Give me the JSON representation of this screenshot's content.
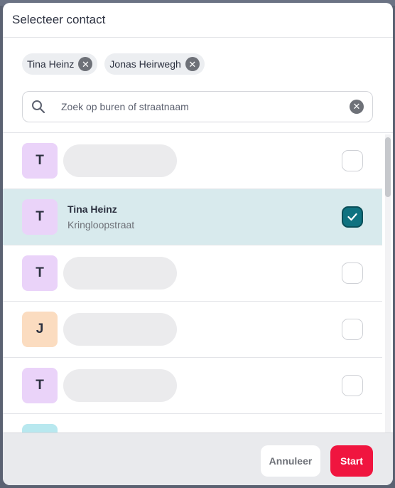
{
  "dialog": {
    "title": "Selecteer contact"
  },
  "selected_chips": [
    {
      "label": "Tina Heinz"
    },
    {
      "label": "Jonas Heirwegh"
    }
  ],
  "search": {
    "placeholder": "Zoek op buren of straatnaam",
    "value": ""
  },
  "contacts": [
    {
      "initial": "T",
      "name": "",
      "street": "",
      "avatar_color": "#ead3f9",
      "checked": false,
      "loaded": false
    },
    {
      "initial": "T",
      "name": "Tina Heinz",
      "street": "Kringloopstraat",
      "avatar_color": "#ead3f9",
      "checked": true,
      "loaded": true
    },
    {
      "initial": "T",
      "name": "",
      "street": "",
      "avatar_color": "#ead3f9",
      "checked": false,
      "loaded": false
    },
    {
      "initial": "J",
      "name": "",
      "street": "",
      "avatar_color": "#fbdcc0",
      "checked": false,
      "loaded": false
    },
    {
      "initial": "T",
      "name": "",
      "street": "",
      "avatar_color": "#ead3f9",
      "checked": false,
      "loaded": false
    },
    {
      "initial": "",
      "name": "",
      "street": "",
      "avatar_color": "#b8e8ef",
      "checked": false,
      "loaded": false
    }
  ],
  "footer": {
    "cancel_label": "Annuleer",
    "start_label": "Start"
  },
  "colors": {
    "accent": "#f0153f",
    "checkbox_checked": "#0f7280",
    "selected_row": "#d8eaed"
  }
}
